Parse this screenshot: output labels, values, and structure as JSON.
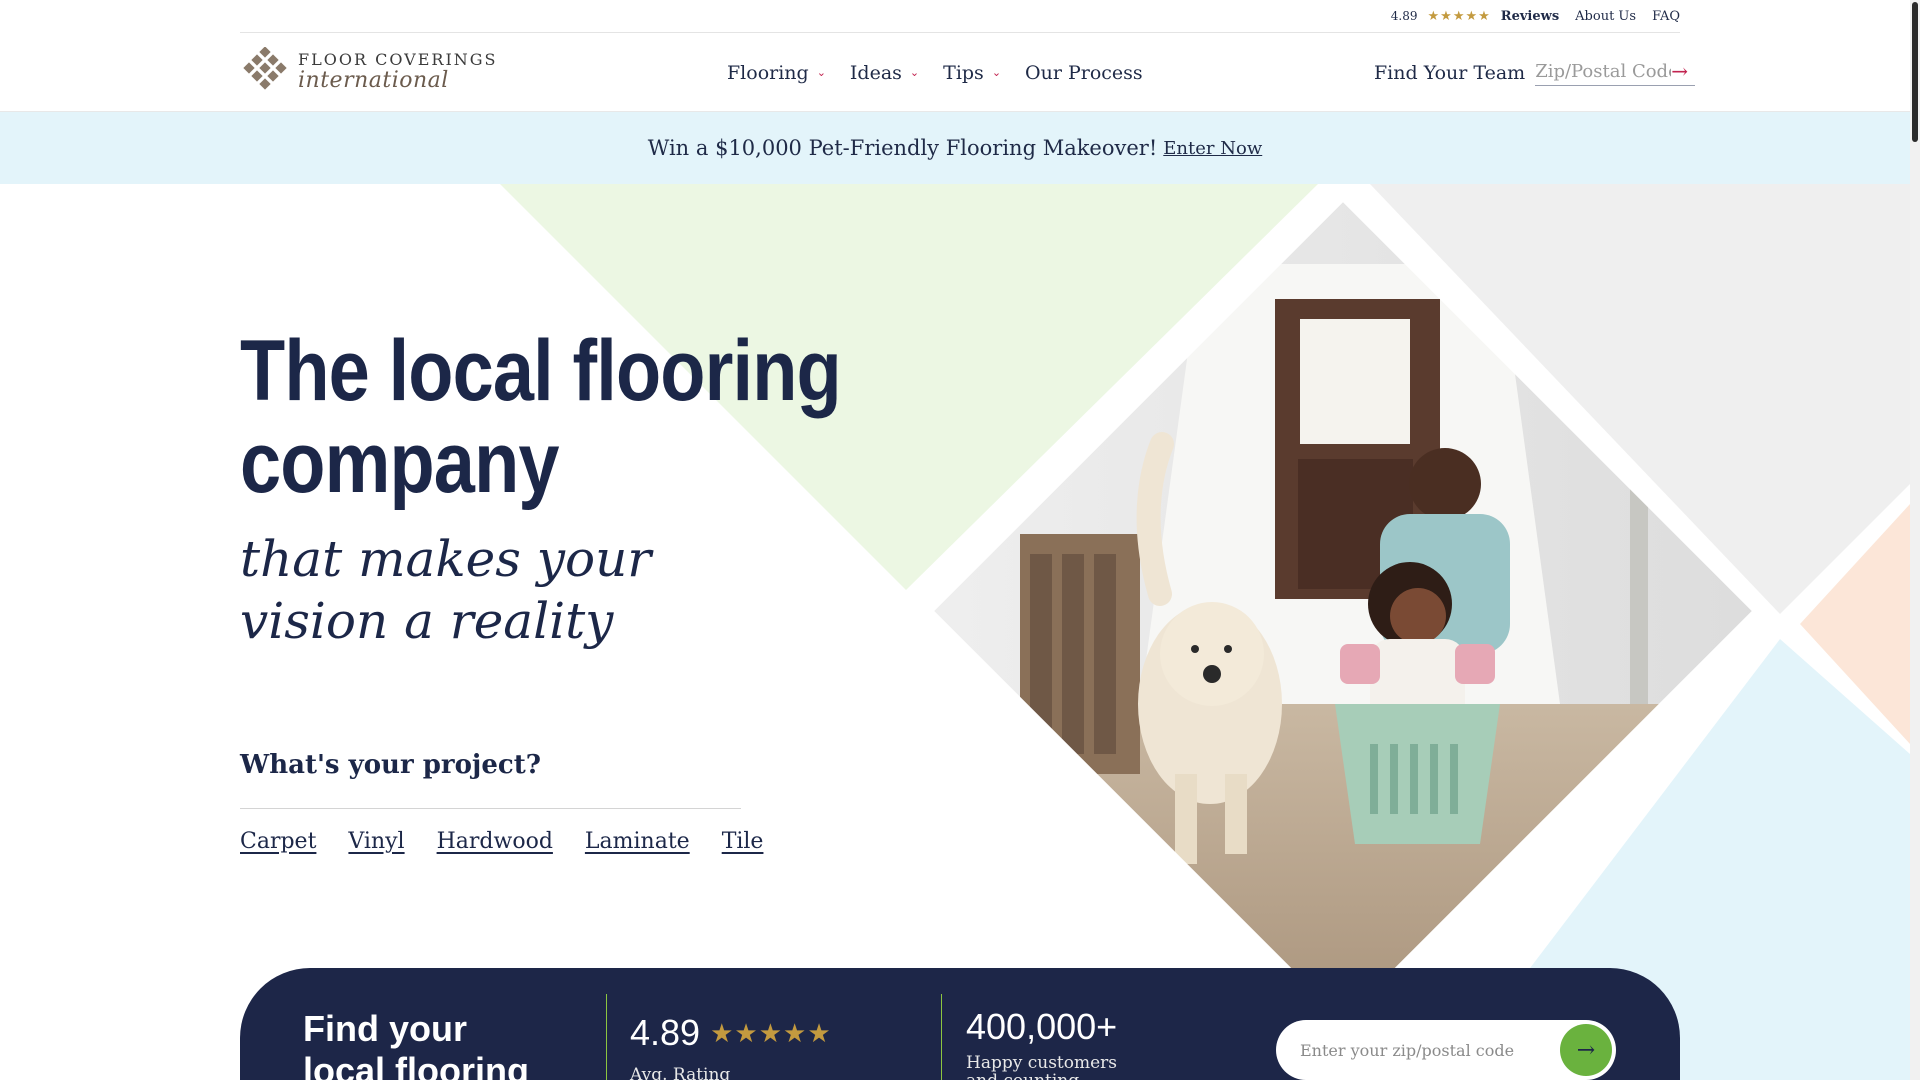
{
  "utility": {
    "rating": "4.89",
    "stars": "★★★★★",
    "reviews": "Reviews",
    "about": "About Us",
    "faq": "FAQ"
  },
  "logo": {
    "line1": "FLOOR COVERINGS",
    "line2": "international"
  },
  "nav": [
    {
      "label": "Flooring",
      "has_menu": true
    },
    {
      "label": "Ideas",
      "has_menu": true
    },
    {
      "label": "Tips",
      "has_menu": true
    },
    {
      "label": "Our Process",
      "has_menu": false
    }
  ],
  "find_team": {
    "label": "Find Your Team",
    "placeholder": "Zip/Postal Code"
  },
  "promo": {
    "text": "Win a $10,000 Pet-Friendly Flooring Makeover!",
    "link": "Enter Now"
  },
  "hero": {
    "title": "The local flooring company",
    "subtitle_1": "that makes your",
    "subtitle_2": "vision a reality",
    "project_question": "What's your project?",
    "projects": [
      "Carpet",
      "Vinyl",
      "Hardwood",
      "Laminate",
      "Tile"
    ]
  },
  "stats": {
    "title": "Find your local flooring team",
    "rating_value": "4.89",
    "rating_stars": "★★★★★",
    "rating_label": "Avg. Rating",
    "customers_value": "400,000+",
    "customers_label_1": "Happy customers",
    "customers_label_2": "and counting",
    "zip_placeholder": "Enter your zip/postal code"
  },
  "colors": {
    "navy": "#1d2648",
    "accent_red": "#c2234f",
    "accent_green": "#6ab23e",
    "gold_star": "#c39a3f",
    "promo_bg": "#e3f4fa",
    "mint": "#ecf7e3",
    "peach": "#fce6d8",
    "sky": "#e3f4fa"
  }
}
